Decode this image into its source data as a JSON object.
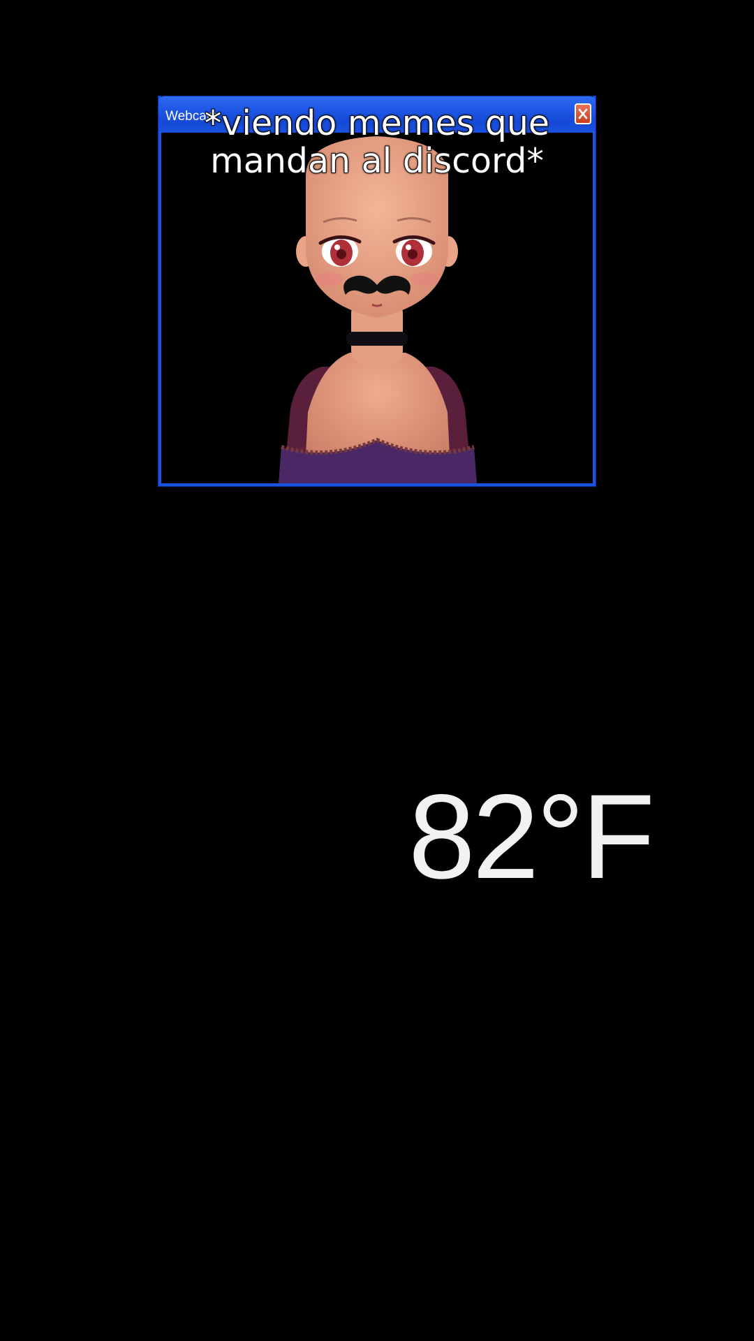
{
  "window": {
    "title": "Webcam",
    "close_label": "X"
  },
  "caption": {
    "line1": "*viendo memes que",
    "line2": "mandan al discord*"
  },
  "weather": {
    "temperature": "82°F"
  },
  "colors": {
    "titlebar": "#1f57e6",
    "border": "#1a53e0",
    "close_button": "#d4522f",
    "background": "#000000"
  }
}
